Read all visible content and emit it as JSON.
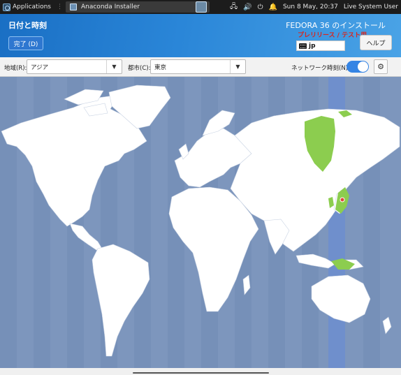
{
  "panel": {
    "applications_label": "Applications",
    "task_label": "Anaconda Installer",
    "datetime": "Sun  8 May, 20:37",
    "user_label": "Live System User"
  },
  "header": {
    "title": "日付と時刻",
    "done_label": "完了 (D)",
    "product": "FEDORA 36 のインストール",
    "prerelease": "プレリリース / テスト用",
    "keyboard_layout": "jp",
    "help_label": "ヘルプ"
  },
  "selectors": {
    "region_label": "地域(R):",
    "region_value": "アジア",
    "city_label": "都市(C):",
    "city_value": "東京",
    "ntp_label": "ネットワーク時刻(N)",
    "ntp_enabled": true
  },
  "map": {
    "ocean_color": "#7d96bd",
    "land_color": "#ffffff",
    "selected_zone_color": "#6f8fcc",
    "highlight_color": "#8ccd4f",
    "marker_color": "#e0463a",
    "selected_city": "東京"
  }
}
